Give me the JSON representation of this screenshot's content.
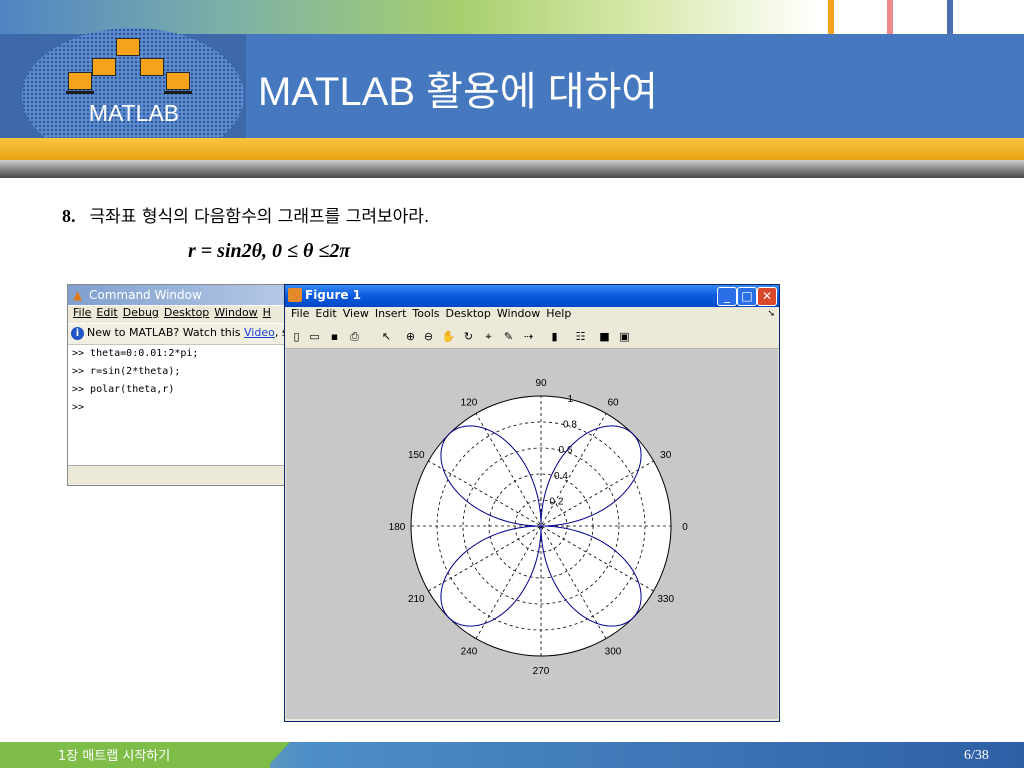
{
  "slide": {
    "title": "MATLAB 활용에 대하여",
    "logo_text": "MATLAB",
    "question_number": "8.",
    "question_text": "극좌표 형식의 다음함수의 그래프를 그려보아라.",
    "formula": "r = sin2θ,  0 ≤ θ ≤2π",
    "footer_label": "1장 매트랩 시작하기",
    "page_number": "6/38",
    "colors": {
      "header": "#4578be",
      "orange": "#f5a31c",
      "footer": "#2e5fa6"
    }
  },
  "command_window": {
    "title": "Command Window",
    "menu": [
      "File",
      "Edit",
      "Debug",
      "Desktop",
      "Window",
      "H"
    ],
    "info_text": "New to MATLAB? Watch this",
    "info_link": "Video",
    "info_tail": ", se",
    "lines": [
      ">> theta=0:0.01:2*pi;",
      ">> r=sin(2*theta);",
      ">> polar(theta,r)",
      ">>"
    ]
  },
  "figure_window": {
    "title": "Figure 1",
    "menu": [
      "File",
      "Edit",
      "View",
      "Insert",
      "Tools",
      "Desktop",
      "Window",
      "Help"
    ],
    "toolbar_icons": [
      "new-icon",
      "open-icon",
      "save-icon",
      "print-icon",
      "pointer-icon",
      "zoom-in-icon",
      "zoom-out-icon",
      "pan-icon",
      "rotate-icon",
      "datacursor-icon",
      "brush-icon",
      "link-icon",
      "colorbar-icon",
      "legend-icon",
      "hide-tools-icon",
      "show-tools-icon"
    ]
  },
  "chart_data": {
    "type": "line",
    "coordinate_system": "polar",
    "function": "r = sin(2*theta)",
    "series": [
      {
        "color": "#00008b",
        "theta_range": [
          0,
          6.283
        ],
        "theta_step": 0.01
      }
    ],
    "r_max": 1,
    "r_ticks": [
      "0.2",
      "0.4",
      "0.6",
      "0.8",
      "1"
    ],
    "angle_labels": [
      "0",
      "30",
      "60",
      "90",
      "120",
      "150",
      "180",
      "210",
      "240",
      "270",
      "300",
      "330"
    ],
    "grid": true
  }
}
